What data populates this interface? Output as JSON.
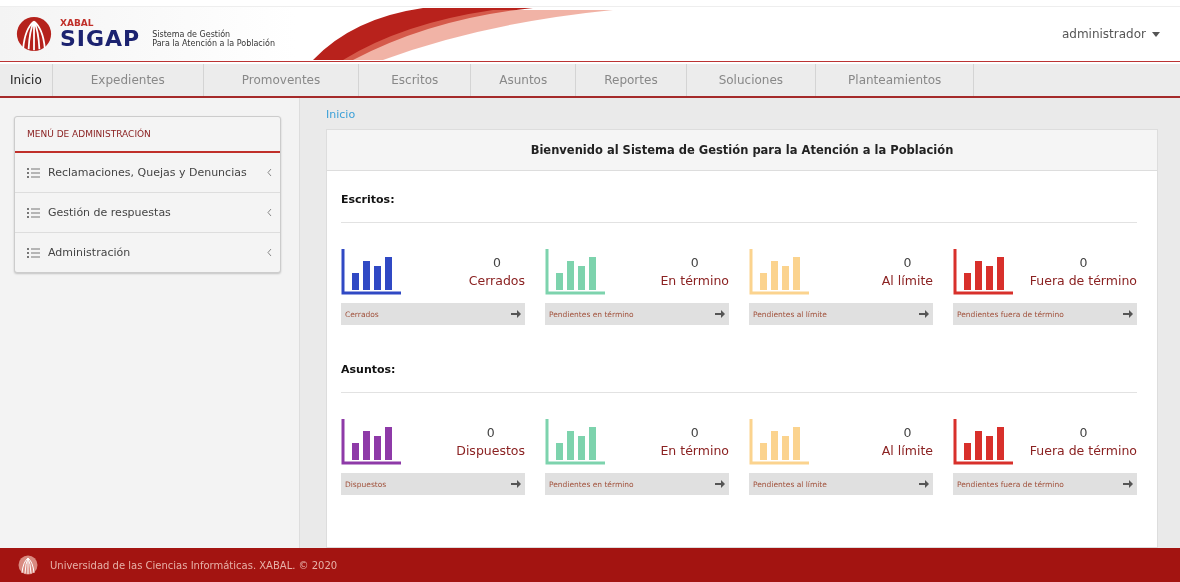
{
  "header": {
    "brand_small": "XABAL",
    "brand": "SIGAP",
    "tagline_1": "Sistema de Gestión",
    "tagline_2": "Para la Atención a la Población",
    "user": "administrador"
  },
  "tabs": [
    {
      "label": "Inicio",
      "selected": true
    },
    {
      "label": "Expedientes",
      "selected": false
    },
    {
      "label": "Promoventes",
      "selected": false
    },
    {
      "label": "Escritos",
      "selected": false
    },
    {
      "label": "Asuntos",
      "selected": false
    },
    {
      "label": "Reportes",
      "selected": false
    },
    {
      "label": "Soluciones",
      "selected": false
    },
    {
      "label": "Planteamientos",
      "selected": false
    }
  ],
  "sidebar": {
    "title": "MENÚ DE ADMINISTRACIÓN",
    "items": [
      {
        "label": "Reclamaciones, Quejas y Denuncias",
        "expanded": false
      },
      {
        "label": "Gestión de respuestas",
        "expanded": false
      },
      {
        "label": "Administración",
        "expanded": false
      }
    ]
  },
  "breadcrumb": "Inicio",
  "panel": {
    "title": "Bienvenido al Sistema de Gestión para la Atención a la Población",
    "sections": [
      {
        "title": "Escritos:",
        "cards": [
          {
            "count": "0",
            "label": "Cerrados",
            "link": "Cerrados",
            "color": "#3049c4"
          },
          {
            "count": "0",
            "label": "En término",
            "link": "Pendientes en término",
            "color": "#7dd3ad"
          },
          {
            "count": "0",
            "label": "Al límite",
            "link": "Pendientes al límite",
            "color": "#fbd38e"
          },
          {
            "count": "0",
            "label": "Fuera de término",
            "link": "Pendientes fuera de término",
            "color": "#d8302b"
          }
        ]
      },
      {
        "title": "Asuntos:",
        "cards": [
          {
            "count": "0",
            "label": "Dispuestos",
            "link": "Dispuestos",
            "color": "#8e3aa8"
          },
          {
            "count": "0",
            "label": "En término",
            "link": "Pendientes en término",
            "color": "#7dd3ad"
          },
          {
            "count": "0",
            "label": "Al límite",
            "link": "Pendientes al límite",
            "color": "#fbd38e"
          },
          {
            "count": "0",
            "label": "Fuera de término",
            "link": "Pendientes fuera de término",
            "color": "#d8302b"
          }
        ]
      }
    ]
  },
  "footer": "Universidad de las Ciencias Informáticas. XABAL. © 2020"
}
